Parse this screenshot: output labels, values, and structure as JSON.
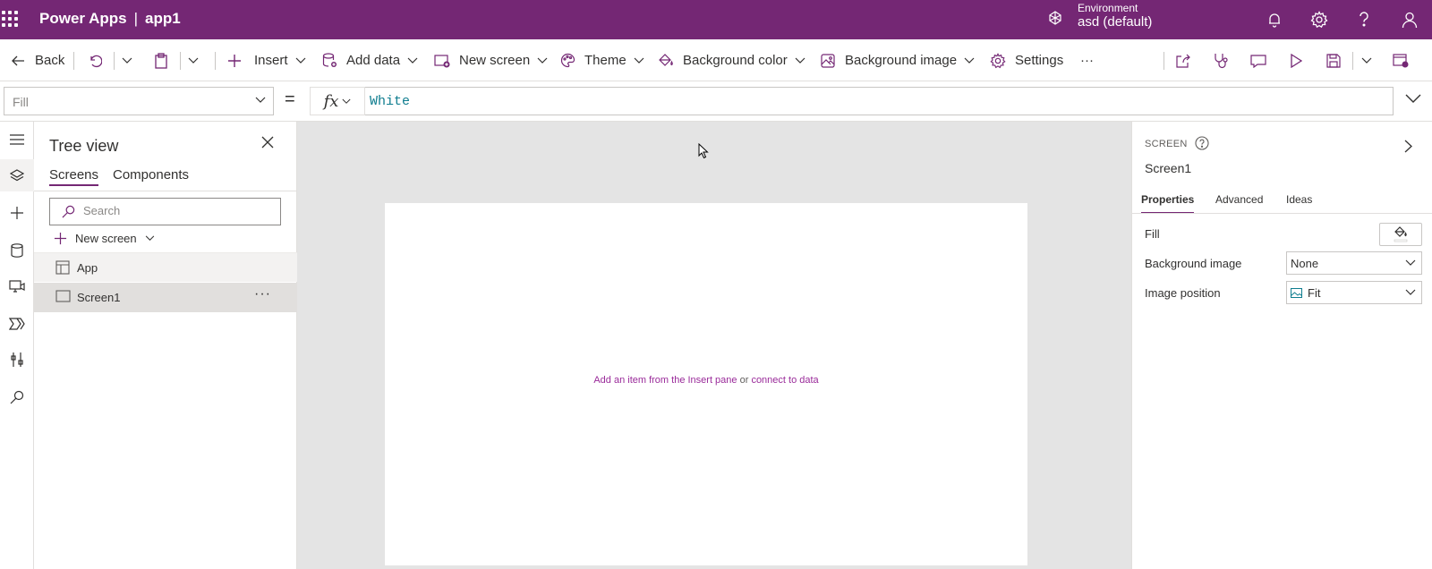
{
  "header": {
    "product": "Power Apps",
    "separator": "|",
    "app_name": "app1",
    "environment_label": "Environment",
    "environment_name": "asd (default)"
  },
  "toolbar": {
    "back": "Back",
    "insert": "Insert",
    "add_data": "Add data",
    "new_screen": "New screen",
    "theme": "Theme",
    "background_color": "Background color",
    "background_image": "Background image",
    "settings": "Settings",
    "more": "···"
  },
  "formula_bar": {
    "property": "Fill",
    "equals": "=",
    "fx": "fx",
    "formula": "White"
  },
  "tree_view": {
    "title": "Tree view",
    "tabs": [
      "Screens",
      "Components"
    ],
    "search_placeholder": "Search",
    "new_screen": "New screen",
    "items": [
      {
        "label": "App"
      },
      {
        "label": "Screen1",
        "more": "···"
      }
    ]
  },
  "canvas": {
    "hint_part1": "Add an item from the Insert pane",
    "hint_or": " or ",
    "hint_link": "connect to data"
  },
  "properties": {
    "type": "SCREEN",
    "name": "Screen1",
    "tabs": [
      "Properties",
      "Advanced",
      "Ideas"
    ],
    "fill_label": "Fill",
    "background_image_label": "Background image",
    "background_image_value": "None",
    "image_position_label": "Image position",
    "image_position_value": "Fit"
  },
  "colors": {
    "brand": "#742774",
    "formula_text": "#0f7d8f",
    "link": "#9a2b9a"
  }
}
